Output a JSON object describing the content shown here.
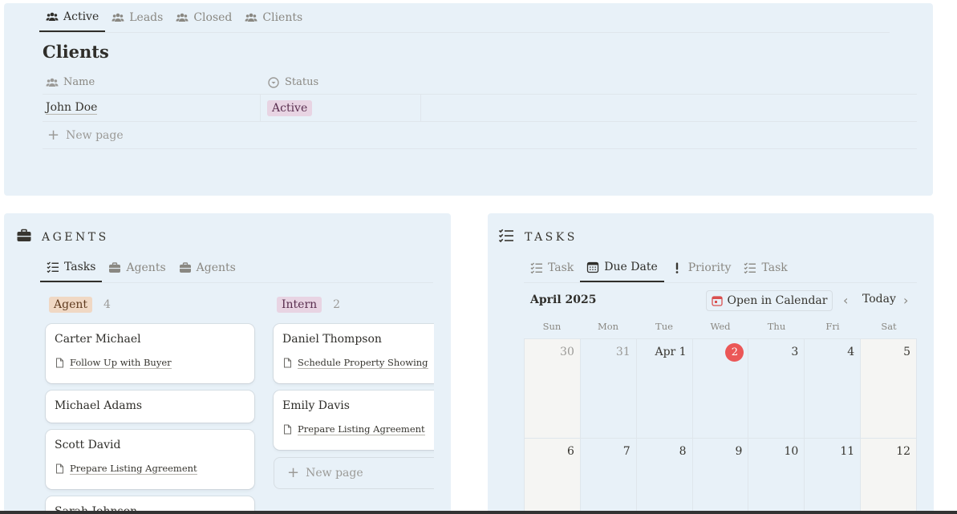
{
  "clients_section": {
    "tabs": [
      {
        "label": "Active",
        "icon": "people-icon",
        "active": true
      },
      {
        "label": "Leads",
        "icon": "people-icon",
        "active": false
      },
      {
        "label": "Closed",
        "icon": "people-icon",
        "active": false
      },
      {
        "label": "Clients",
        "icon": "people-icon",
        "active": false
      }
    ],
    "title": "Clients",
    "columns": [
      {
        "label": "Name",
        "icon": "people-icon"
      },
      {
        "label": "Status",
        "icon": "status-circle-icon"
      }
    ],
    "rows": [
      {
        "name": "John Doe",
        "status": "Active"
      }
    ],
    "new_page_label": "New page"
  },
  "agents_section": {
    "title": "AGENTS",
    "icon": "briefcase-icon",
    "tabs": [
      {
        "label": "Tasks",
        "icon": "checklist-icon",
        "active": true
      },
      {
        "label": "Agents",
        "icon": "briefcase-icon",
        "active": false
      },
      {
        "label": "Agents",
        "icon": "briefcase-icon",
        "active": false
      }
    ],
    "groups": [
      {
        "label": "Agent",
        "count": "4",
        "cards": [
          {
            "title": "Carter Michael",
            "link": "Follow Up with Buyer"
          },
          {
            "title": "Michael Adams",
            "link": ""
          },
          {
            "title": "Scott David",
            "link": "Prepare Listing Agreement"
          },
          {
            "title": "Sarah Johnson",
            "link": ""
          }
        ]
      },
      {
        "label": "Intern",
        "count": "2",
        "cards": [
          {
            "title": "Daniel Thompson",
            "link": "Schedule Property Showing"
          },
          {
            "title": "Emily Davis",
            "link": "Prepare Listing Agreement"
          }
        ],
        "new_page_label": "New page"
      }
    ]
  },
  "tasks_section": {
    "title": "TASKS",
    "icon": "checklist-icon",
    "tabs": [
      {
        "label": "Task",
        "icon": "checklist-icon",
        "active": false
      },
      {
        "label": "Due Date",
        "icon": "calendar-icon",
        "active": true
      },
      {
        "label": "Priority",
        "icon": "exclamation-icon",
        "active": false
      },
      {
        "label": "Task",
        "icon": "checklist-icon",
        "active": false
      }
    ],
    "calendar": {
      "month_label": "April 2025",
      "open_button": "Open in Calendar",
      "today_label": "Today",
      "weekdays": [
        "Sun",
        "Mon",
        "Tue",
        "Wed",
        "Thu",
        "Fri",
        "Sat"
      ],
      "weeks": [
        [
          "30",
          "31",
          "Apr 1",
          "2",
          "3",
          "4",
          "5"
        ],
        [
          "6",
          "7",
          "8",
          "9",
          "10",
          "11",
          "12"
        ]
      ],
      "today_date": "2"
    }
  },
  "colors": {
    "panel_bg": "#e8f1f8",
    "today_red": "#eb5757",
    "pill_agent": "#f0d8c4",
    "pill_purple": "#e8d4e3"
  }
}
